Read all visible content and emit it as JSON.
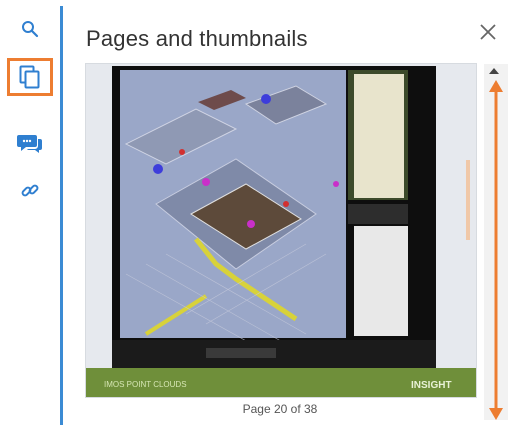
{
  "panel": {
    "title": "Pages and thumbnails",
    "page_indicator": "Page 20 of 38"
  },
  "toolbar": {
    "items": [
      {
        "name": "search",
        "icon": "search-icon",
        "active": false
      },
      {
        "name": "pages",
        "icon": "pages-icon",
        "active": true
      },
      {
        "name": "comments",
        "icon": "comment-icon",
        "active": false
      },
      {
        "name": "link",
        "icon": "link-icon",
        "active": false
      }
    ]
  },
  "thumbnail": {
    "footer_left": "IMOS POINT CLOUDS",
    "footer_right": "INSIGHT"
  },
  "colors": {
    "accent_blue": "#3b8bd4",
    "highlight_orange": "#ed7d31",
    "footer_green": "#6f8f3a"
  }
}
